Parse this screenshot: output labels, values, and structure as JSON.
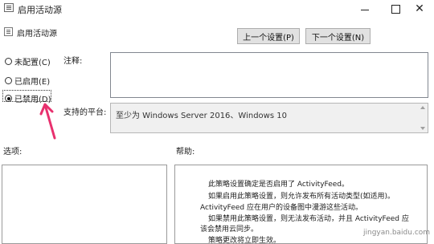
{
  "window": {
    "title": "启用活动源"
  },
  "header": {
    "policy_title": "启用活动源",
    "prev_button": "上一个设置(P)",
    "next_button": "下一个设置(N)"
  },
  "options": {
    "items": [
      {
        "label": "未配置(C)",
        "selected": false
      },
      {
        "label": "已启用(E)",
        "selected": false
      },
      {
        "label": "已禁用(D)",
        "selected": true
      }
    ]
  },
  "fields": {
    "comment_label": "注释:",
    "comment_value": "",
    "platform_label": "支持的平台:",
    "platform_value": "至少为 Windows Server 2016、Windows 10",
    "options_label": "选项:",
    "help_label": "帮助:"
  },
  "help": {
    "lines": [
      "此策略设置确定是否启用了 ActivityFeed。",
      "如果启用此策略设置，则允许发布所有活动类型(如适用)。",
      "ActivityFeed 应在用户的设备图中漫游这些活动。",
      "如果禁用此策略设置，则无法发布活动，并且 ActivityFeed 应",
      "该会禁用云同步。",
      "策略更改将立即生效。"
    ]
  },
  "annotation": {
    "arrow_color": "#e8306e"
  },
  "watermark": {
    "text": "jingyan.baidu.com"
  }
}
